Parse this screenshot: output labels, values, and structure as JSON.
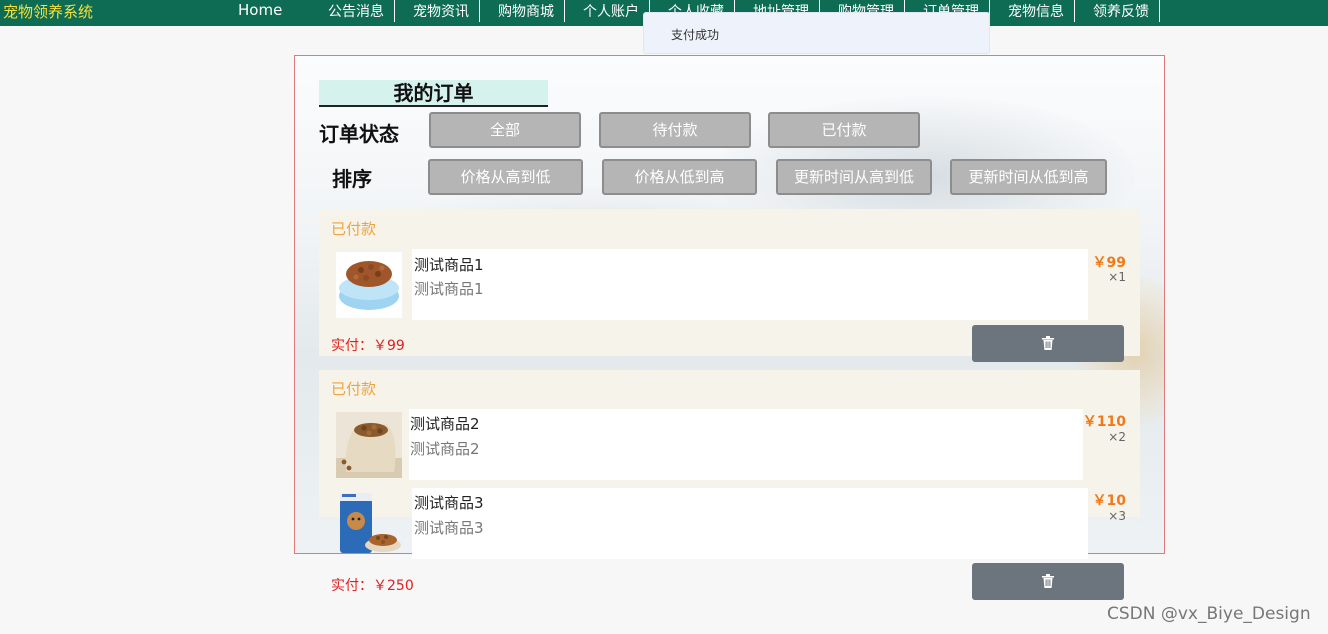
{
  "brand": "宠物领养系统",
  "nav": {
    "home": "Home",
    "items": [
      "公告消息",
      "宠物资讯",
      "购物商城",
      "个人账户",
      "个人收藏",
      "地址管理",
      "购物管理",
      "订单管理",
      "宠物信息",
      "领养反馈"
    ]
  },
  "toast": {
    "message": "支付成功"
  },
  "page": {
    "title": "我的订单",
    "status_label": "订单状态",
    "sort_label": "排序",
    "status_filters": [
      "全部",
      "待付款",
      "已付款"
    ],
    "sort_options": [
      "价格从高到低",
      "价格从低到高",
      "更新时间从高到低",
      "更新时间从低到高"
    ]
  },
  "orders": [
    {
      "status": "已付款",
      "items": [
        {
          "name": "测试商品1",
          "desc": "测试商品1",
          "price": "￥99",
          "qty": "×1",
          "image": "dog-bowl-food"
        }
      ],
      "paid_label": "实付：",
      "paid_amount": "￥99",
      "delete_icon": "trash-icon"
    },
    {
      "status": "已付款",
      "items": [
        {
          "name": "测试商品2",
          "desc": "测试商品2",
          "price": "￥110",
          "qty": "×2",
          "image": "kibble-sack"
        },
        {
          "name": "测试商品3",
          "desc": "测试商品3",
          "price": "￥10",
          "qty": "×3",
          "image": "cat-food-bag"
        }
      ],
      "paid_label": "实付：",
      "paid_amount": "￥250",
      "delete_icon": "trash-icon"
    }
  ],
  "watermark": "CSDN @vx_Biye_Design",
  "colors": {
    "nav_bg": "#0e6b54",
    "brand": "#f4e23a",
    "delete_btn": "#6c757d",
    "status": "#f0a33a",
    "paid": "#e02020"
  }
}
